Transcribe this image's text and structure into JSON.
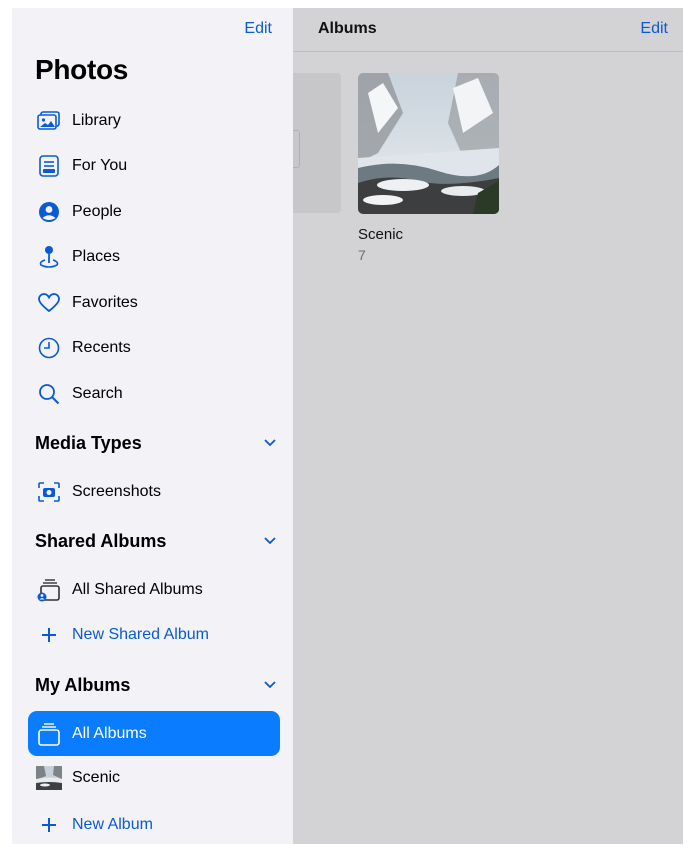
{
  "sidebar": {
    "edit_label": "Edit",
    "title": "Photos",
    "items": [
      {
        "label": "Library",
        "icon": "library-icon"
      },
      {
        "label": "For You",
        "icon": "for-you-icon"
      },
      {
        "label": "People",
        "icon": "people-icon"
      },
      {
        "label": "Places",
        "icon": "places-icon"
      },
      {
        "label": "Favorites",
        "icon": "heart-icon"
      },
      {
        "label": "Recents",
        "icon": "clock-icon"
      },
      {
        "label": "Search",
        "icon": "search-icon"
      }
    ],
    "sections": {
      "media_types": {
        "label": "Media Types",
        "items": [
          {
            "label": "Screenshots",
            "icon": "screenshot-icon"
          }
        ]
      },
      "shared_albums": {
        "label": "Shared Albums",
        "items": [
          {
            "label": "All Shared Albums",
            "icon": "shared-albums-icon"
          },
          {
            "label": "New Shared Album",
            "icon": "plus-icon"
          }
        ]
      },
      "my_albums": {
        "label": "My Albums",
        "items": [
          {
            "label": "All Albums",
            "icon": "albums-icon",
            "selected": true
          },
          {
            "label": "Scenic",
            "icon": "album-thumbnail"
          },
          {
            "label": "New Album",
            "icon": "plus-icon"
          }
        ]
      }
    }
  },
  "main": {
    "title": "Albums",
    "edit_label": "Edit",
    "albums": [
      {
        "name": "Scenic",
        "count": "7"
      }
    ]
  },
  "colors": {
    "accent": "#0a5ad4",
    "selected_bg": "#0a7cff",
    "sidebar_bg": "#f2f2f7",
    "dim_bg": "#d3d3d5"
  }
}
